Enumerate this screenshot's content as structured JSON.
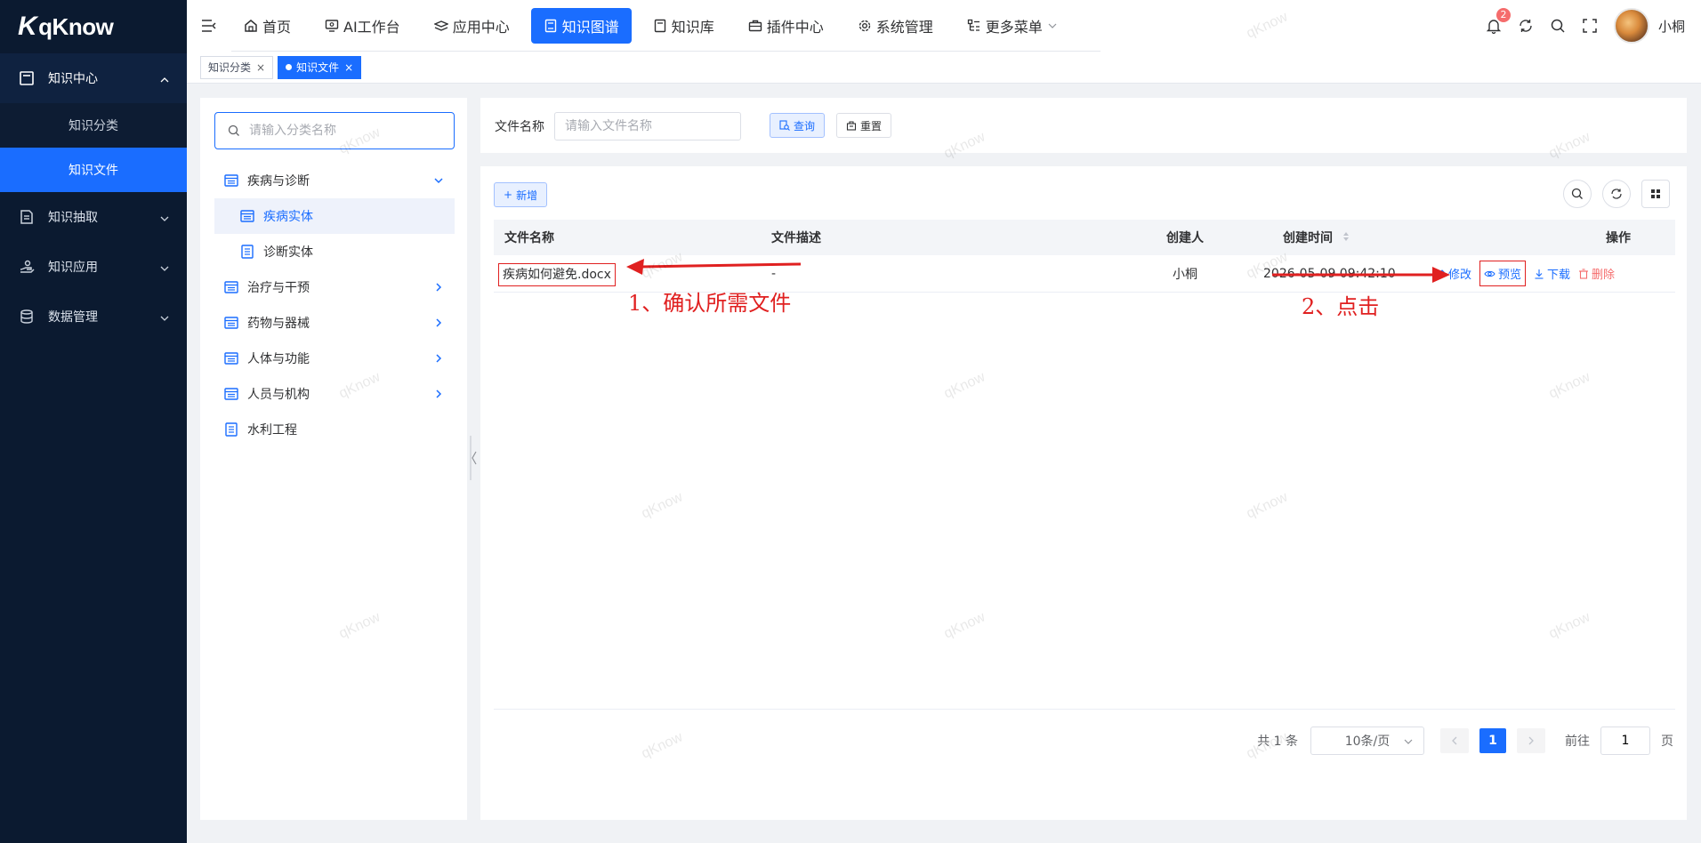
{
  "app": {
    "logo_text": "qKnow",
    "logo_mark": "K"
  },
  "sidebar": {
    "groups": [
      {
        "label": "知识中心",
        "open": true,
        "children": [
          "知识分类",
          "知识文件"
        ],
        "active_child": 1
      },
      {
        "label": "知识抽取",
        "open": false
      },
      {
        "label": "知识应用",
        "open": false
      },
      {
        "label": "数据管理",
        "open": false
      }
    ]
  },
  "topnav": {
    "items": [
      "首页",
      "AI工作台",
      "应用中心",
      "知识图谱",
      "知识库",
      "插件中心",
      "系统管理",
      "更多菜单"
    ],
    "active_index": 3,
    "notification_count": "2",
    "username": "小桐"
  },
  "tabs": [
    {
      "label": "知识分类",
      "active": false
    },
    {
      "label": "知识文件",
      "active": true
    }
  ],
  "tree": {
    "search_placeholder": "请输入分类名称",
    "nodes": [
      {
        "label": "疾病与诊断",
        "expanded": true
      },
      {
        "label": "疾病实体",
        "child": true,
        "selected": true
      },
      {
        "label": "诊断实体",
        "child": true
      },
      {
        "label": "治疗与干预"
      },
      {
        "label": "药物与器械"
      },
      {
        "label": "人体与功能"
      },
      {
        "label": "人员与机构"
      },
      {
        "label": "水利工程"
      }
    ]
  },
  "filter": {
    "label": "文件名称",
    "placeholder": "请输入文件名称",
    "query_label": "查询",
    "reset_label": "重置"
  },
  "table": {
    "add_label": "新增",
    "columns": [
      "文件名称",
      "文件描述",
      "创建人",
      "创建时间",
      "操作"
    ],
    "rows": [
      {
        "name": "疾病如何避免.docx",
        "desc": "-",
        "creator": "小桐",
        "created": "2026-05-09 09:42:10",
        "ops": [
          "修改",
          "预览",
          "下载",
          "删除"
        ]
      }
    ]
  },
  "pagination": {
    "total": "共 1 条",
    "page_size": "10条/页",
    "current": "1",
    "goto_label": "前往",
    "goto_value": "1",
    "page_suffix": "页"
  },
  "annotations": {
    "step1": "1、确认所需文件",
    "step2": "2、点击"
  },
  "watermark": "qKnow",
  "colors": {
    "primary": "#1a6dff",
    "sidebar_bg": "#0b1a30",
    "danger": "#f56c6c",
    "annot": "#e02020"
  }
}
